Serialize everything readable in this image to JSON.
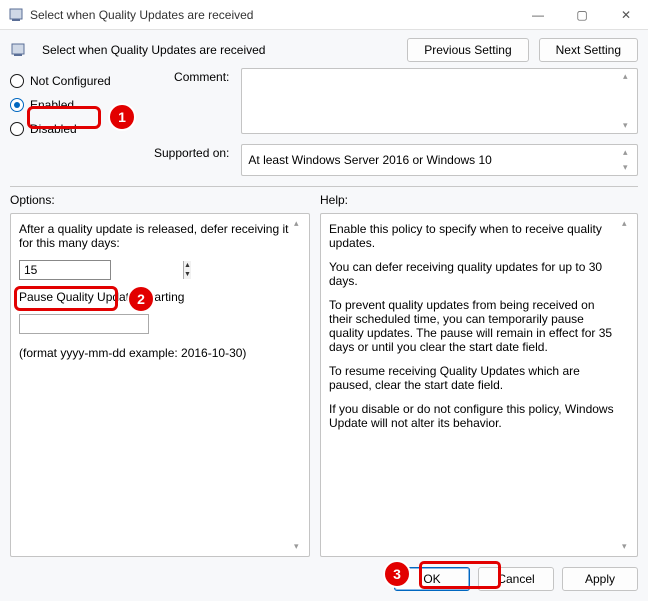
{
  "title": "Select when Quality Updates are received",
  "win_controls": {
    "min": "—",
    "max": "▢",
    "close": "✕"
  },
  "header": {
    "title": "Select when Quality Updates are received",
    "previous": "Previous Setting",
    "next": "Next Setting"
  },
  "radios": {
    "not_configured": "Not Configured",
    "enabled": "Enabled",
    "disabled": "Disabled",
    "selected": "enabled"
  },
  "comment": {
    "label": "Comment:",
    "value": ""
  },
  "supported": {
    "label": "Supported on:",
    "value": "At least Windows Server 2016 or Windows 10"
  },
  "sections": {
    "options": "Options:",
    "help": "Help:"
  },
  "options": {
    "defer_label": "After a quality update is released, defer receiving it for this many days:",
    "defer_value": "15",
    "pause_label": "Pause Quality Updates starting",
    "pause_value": "",
    "format_hint": "(format yyyy-mm-dd example: 2016-10-30)"
  },
  "help": {
    "p1": "Enable this policy to specify when to receive quality updates.",
    "p2": "You can defer receiving quality updates for up to 30 days.",
    "p3": "To prevent quality updates from being received on their scheduled time, you can temporarily pause quality updates. The pause will remain in effect for 35 days or until you clear the start date field.",
    "p4": "To resume receiving Quality Updates which are paused, clear the start date field.",
    "p5": "If you disable or do not configure this policy, Windows Update will not alter its behavior."
  },
  "footer": {
    "ok": "OK",
    "cancel": "Cancel",
    "apply": "Apply"
  },
  "callouts": {
    "c1": "1",
    "c2": "2",
    "c3": "3"
  }
}
